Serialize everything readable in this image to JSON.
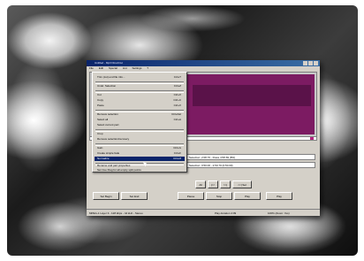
{
  "window": {
    "title": "Untitled - Mp3 DirectCut",
    "menus": [
      "File",
      "Edit",
      "Special",
      "List",
      "Settings",
      "?"
    ]
  },
  "edit_menu": {
    "items": [
      {
        "label": "Trim (cut) end file info...",
        "shortcut": "Ctrl+T"
      },
      {
        "label": "Undo: Selection",
        "shortcut": "Ctrl+Z"
      },
      {
        "label": "Cut",
        "shortcut": "Ctrl+X"
      },
      {
        "label": "Copy",
        "shortcut": "Ctrl+C"
      },
      {
        "label": "Paste",
        "shortcut": "Ctrl+V"
      },
      {
        "label": "Remove selection",
        "shortcut": "Ctrl+Del"
      },
      {
        "label": "Select all",
        "shortcut": "Ctrl+A"
      },
      {
        "label": "Select current part",
        "shortcut": ""
      },
      {
        "label": "Crop",
        "shortcut": ""
      },
      {
        "label": "Remove selection/recovery",
        "shortcut": ""
      },
      {
        "label": "Gain",
        "shortcut": "Ctrl+G"
      },
      {
        "label": "Create simple fade",
        "shortcut": "Ctrl+F"
      },
      {
        "label": "Normalize",
        "shortcut": "Ctrl+M"
      },
      {
        "label": "Rename and part properties",
        "shortcut": ""
      },
      {
        "label": "Set Cue Flag for all empty split points",
        "shortcut": ""
      }
    ],
    "highlighted": "Normalize"
  },
  "fields": {
    "sel1": "Selection: 2:08.76 - Rows 4:58.69 (8%)",
    "sel2": "Selection: 0:50.00 - 2:50.70 (0:50.00)"
  },
  "buttons": [
    "Set Begin",
    "Set End",
    "Pause",
    "Stop",
    "Play",
    "Play"
  ],
  "small_buttons": [
    "All",
    "|<<",
    ">>|",
    "<<| Sel"
  ],
  "status": {
    "left": "MPEG-1 Layer 3 - 128 kbps - 44 kHz - Stereo",
    "mid": "Play duration 4:09",
    "right": "100% (Zoom: Yes)"
  }
}
